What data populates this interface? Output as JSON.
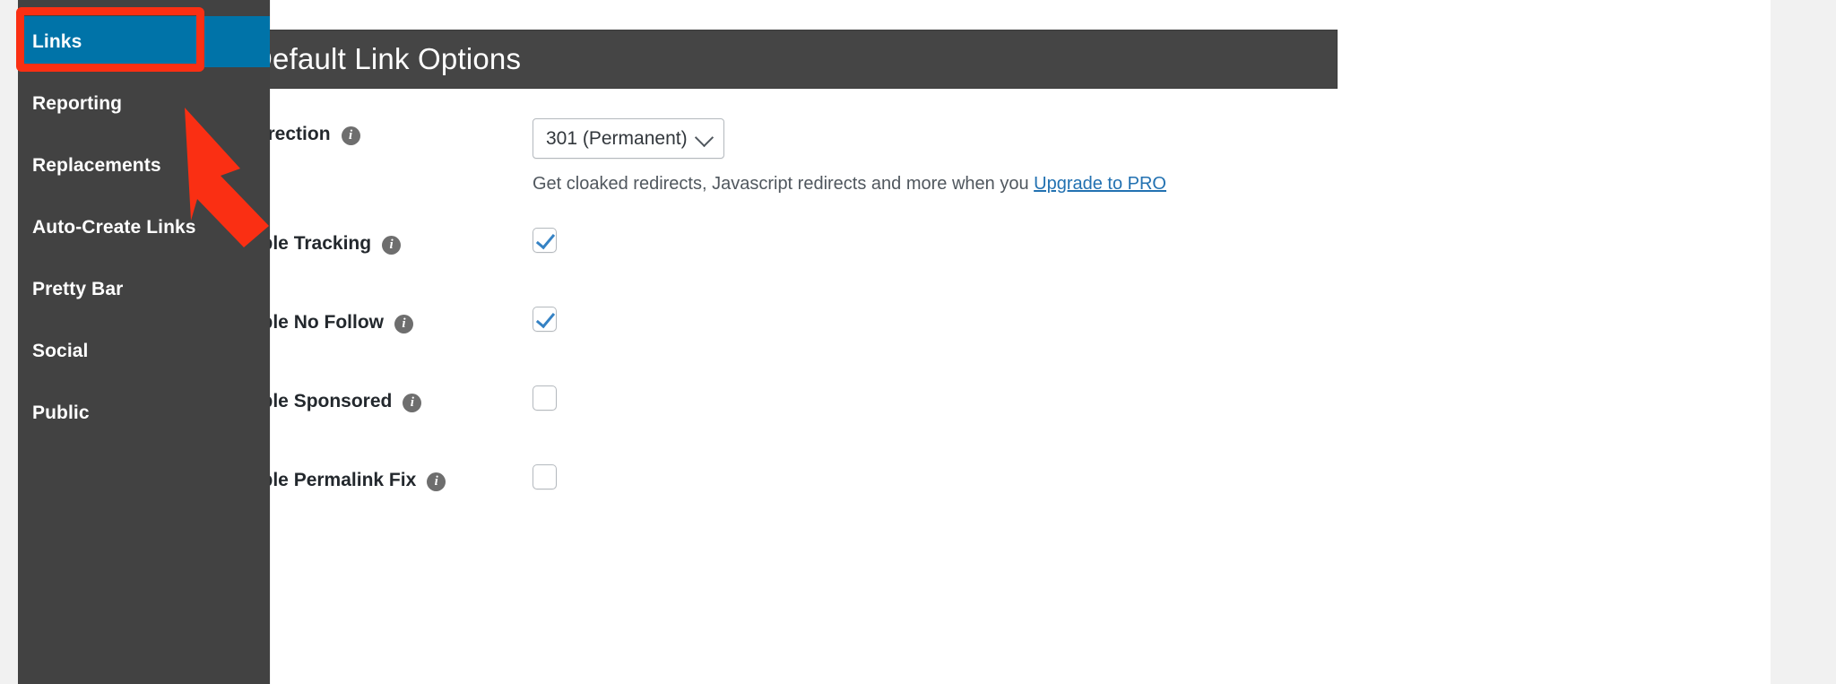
{
  "window": {
    "background_color": "#f1f1f1",
    "panel_color": "#ffffff"
  },
  "sidebar": {
    "background_color": "#424242",
    "active_color": "#0073a8",
    "items": [
      {
        "label": "Links",
        "name": "links",
        "active": true
      },
      {
        "label": "Reporting",
        "name": "reporting",
        "active": false
      },
      {
        "label": "Replacements",
        "name": "replacements",
        "active": false
      },
      {
        "label": "Auto-Create Links",
        "name": "auto-create-links",
        "active": false
      },
      {
        "label": "Pretty Bar",
        "name": "pretty-bar",
        "active": false
      },
      {
        "label": "Social",
        "name": "social",
        "active": false
      },
      {
        "label": "Public",
        "name": "public",
        "active": false
      }
    ]
  },
  "annotation": {
    "highlight_color": "#fa2f13",
    "arrow_color": "#fa2f13",
    "highlight_target": "Links",
    "arrow_points_to": "Links"
  },
  "header": {
    "title": "Default Link Options",
    "background_color": "#454545",
    "text_color": "#ffffff"
  },
  "form": {
    "rows": [
      {
        "name": "redirection",
        "label": "Redirection",
        "info_icon": "info-icon",
        "control": "select",
        "value": "301 (Permanent)",
        "chevron_icon": "chevron-down-icon",
        "help_text_before": "Get cloaked redirects, Javascript redirects and more when you ",
        "help_link": "Upgrade to PRO",
        "help_link_color": "#2271b1"
      },
      {
        "name": "enable-tracking",
        "label": "Enable Tracking",
        "info_icon": "info-icon",
        "control": "checkbox",
        "checked": true
      },
      {
        "name": "enable-no-follow",
        "label": "Enable No Follow",
        "info_icon": "info-icon",
        "control": "checkbox",
        "checked": true
      },
      {
        "name": "enable-sponsored",
        "label": "Enable Sponsored",
        "info_icon": "info-icon",
        "control": "checkbox",
        "checked": false
      },
      {
        "name": "enable-permalink-fix",
        "label": "Enable Permalink Fix",
        "info_icon": "info-icon",
        "control": "checkbox",
        "checked": false
      }
    ],
    "info_glyph": "i",
    "checkbox_check_color": "#3582c4"
  }
}
